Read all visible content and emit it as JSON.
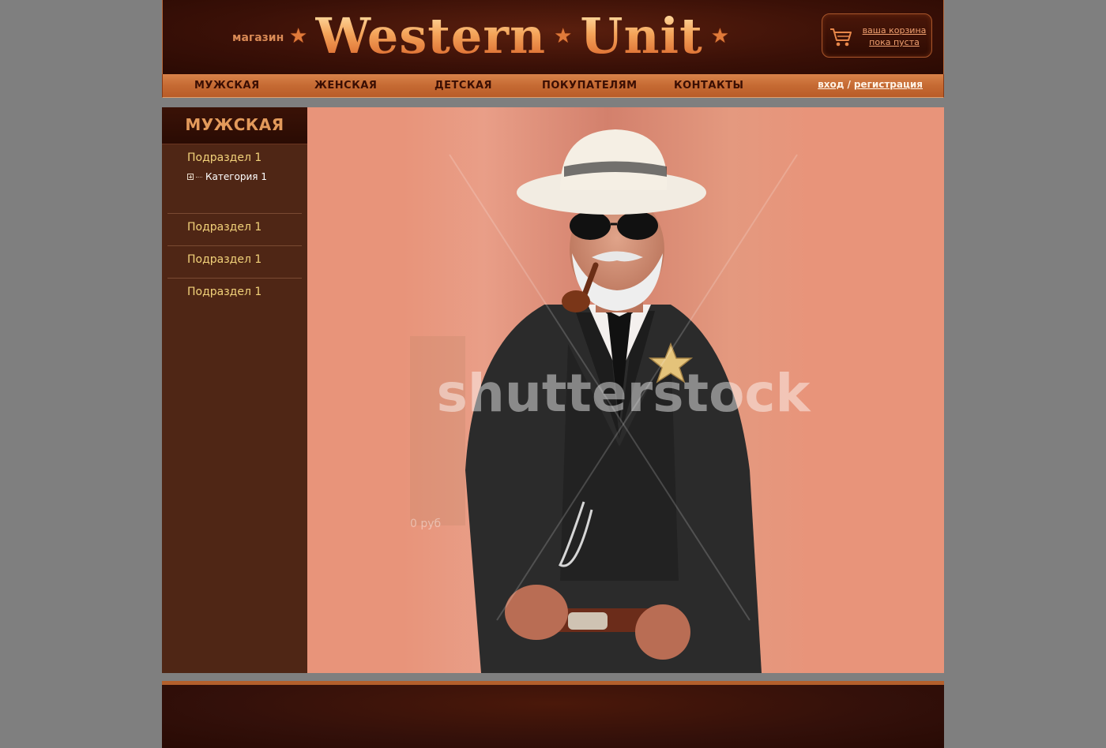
{
  "header": {
    "shop_word": "магазин",
    "logo_word1": "Western",
    "logo_word2": "Unit",
    "cart": {
      "line1": "ваша корзина",
      "line2": "пока пуста"
    }
  },
  "nav": {
    "items": [
      {
        "label": "МУЖСКАЯ"
      },
      {
        "label": "ЖЕНСКАЯ"
      },
      {
        "label": "ДЕТСКАЯ"
      },
      {
        "label": "ПОКУПАТЕЛЯМ"
      },
      {
        "label": "КОНТАКТЫ"
      }
    ],
    "login": "вход",
    "separator": "/",
    "register": "регистрация"
  },
  "sidebar": {
    "title": "МУЖСКАЯ",
    "sections": [
      {
        "label": "Подраздел 1",
        "categories": [
          {
            "label": "Категория 1"
          }
        ]
      },
      {
        "label": "Подраздел 1"
      },
      {
        "label": "Подраздел 1"
      },
      {
        "label": "Подраздел 1"
      }
    ]
  },
  "main": {
    "watermark": "shutterstock",
    "price_fragment": "0 руб"
  },
  "colors": {
    "page_bg": "#7f7f7f",
    "header_bg": "#3a1007",
    "nav_bg": "#c56a33",
    "sidebar_bg": "#4f2615",
    "subsection_text": "#f2d27a",
    "image_bg": "#e8947a"
  },
  "icons": [
    "star-icon",
    "cart-icon",
    "plus-expand-icon"
  ]
}
